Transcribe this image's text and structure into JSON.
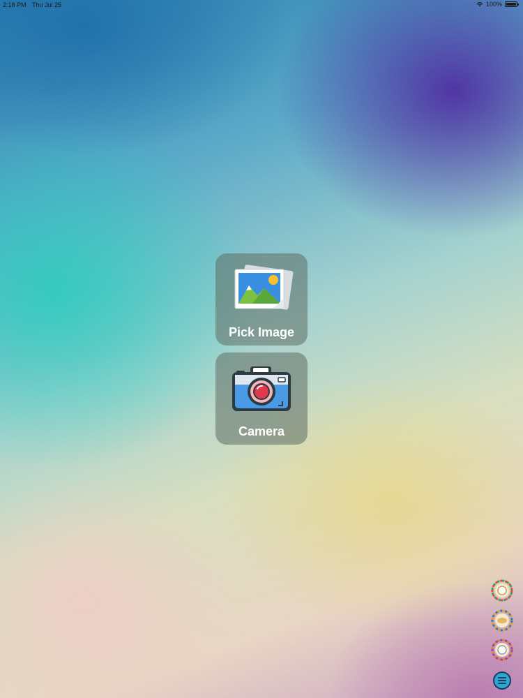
{
  "status_bar": {
    "time": "2:18 PM",
    "date": "Thu Jul 25",
    "battery": "100%"
  },
  "actions": {
    "pick_image_label": "Pick Image",
    "camera_label": "Camera"
  },
  "icons": {
    "pick_image": "photo-gallery-icon",
    "camera": "camera-icon",
    "side_1": "mandala-badge-icon",
    "side_2": "mandala-badge-icon",
    "side_3": "mandala-badge-icon",
    "menu": "menu-icon"
  },
  "colors": {
    "tile_background": "#5f6e64",
    "menu_button": "#2aa7d6"
  }
}
